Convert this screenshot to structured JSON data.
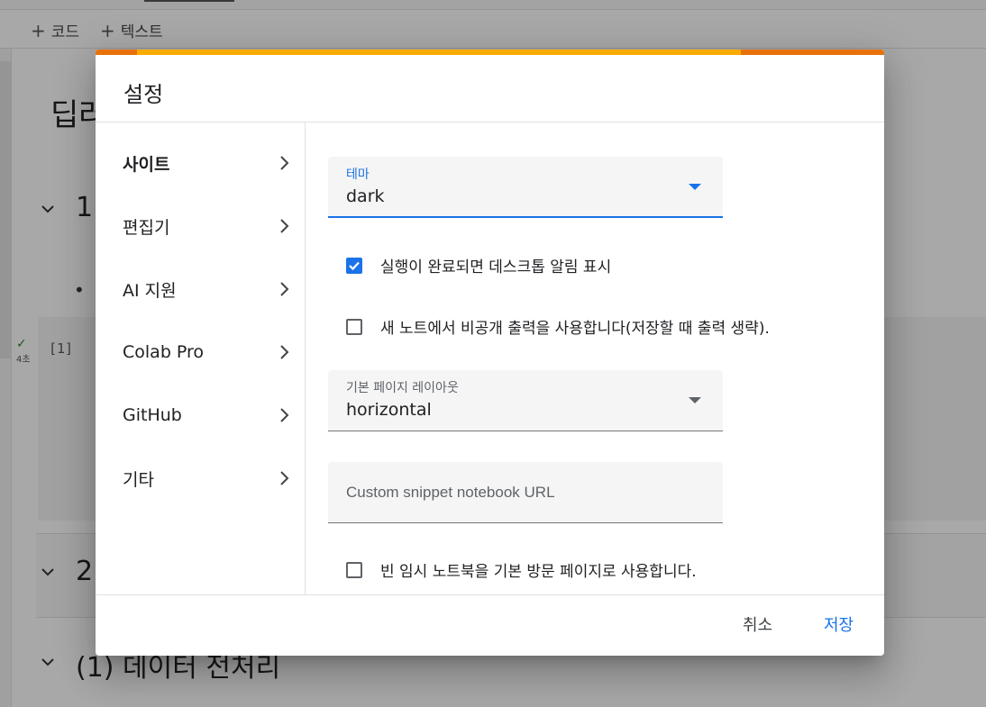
{
  "toolbar": {
    "code_label": "코드",
    "text_label": "텍스트",
    "plus": "+"
  },
  "notebook": {
    "title_fragment": "딥러",
    "section1_fragment": "1.",
    "section2_fragment": "2.",
    "section3": "(1) 데이터 전처리",
    "bullet": "•",
    "cell_number": "[1]",
    "cell_time": "4초",
    "cell_check": "✓"
  },
  "dialog": {
    "title": "설정",
    "nav": [
      {
        "label": "사이트",
        "active": true
      },
      {
        "label": "편집기"
      },
      {
        "label": "AI 지원"
      },
      {
        "label": "Colab Pro"
      },
      {
        "label": "GitHub"
      },
      {
        "label": "기타"
      }
    ],
    "theme": {
      "label": "테마",
      "value": "dark"
    },
    "notify_checkbox": {
      "label": "실행이 완료되면 데스크톱 알림 표시",
      "checked": true
    },
    "private_output_checkbox": {
      "label": "새 노트에서 비공개 출력을 사용합니다(저장할 때 출력 생략).",
      "checked": false
    },
    "layout": {
      "label": "기본 페이지 레이아웃",
      "value": "horizontal"
    },
    "snippet_url": {
      "placeholder": "Custom snippet notebook URL",
      "value": ""
    },
    "scratch_checkbox": {
      "label": "빈 임시 노트북을 기본 방문 페이지로 사용합니다.",
      "checked": false
    },
    "cancel_label": "취소",
    "save_label": "저장"
  },
  "colors": {
    "accent": "#1a73e8",
    "topbar_yellow": "#f9ab00",
    "topbar_orange": "#e8710a"
  }
}
